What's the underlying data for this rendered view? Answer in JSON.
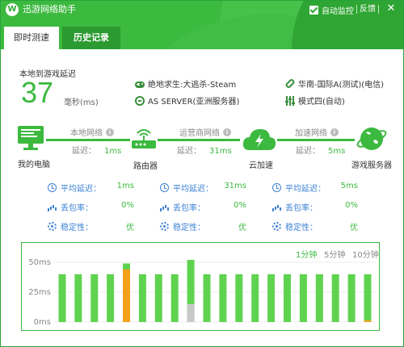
{
  "app": {
    "title": "迅游网络助手",
    "logo_text": "W",
    "auto_monitor_label": "自动监控",
    "auto_monitor_checked": true,
    "feedback_label": "反馈",
    "close_label": "✕"
  },
  "tabs": [
    {
      "label": "即时测速",
      "active": true
    },
    {
      "label": "历史记录",
      "active": false
    }
  ],
  "summary": {
    "latency_label": "本地到游戏延迟",
    "latency_value": "37",
    "latency_unit": "毫秒(ms)",
    "game": "绝地求生:大逃杀-Steam",
    "server": "AS SERVER(亚洲服务器)",
    "route": "华南-国际A(测试)(电信)",
    "mode": "模式四(自动)"
  },
  "nodes": [
    {
      "label": "我的电脑",
      "icon": "computer-icon"
    },
    {
      "label": "路由器",
      "icon": "router-icon"
    },
    {
      "label": "云加速",
      "icon": "cloud-accel-icon"
    },
    {
      "label": "游戏服务器",
      "icon": "game-server-icon"
    }
  ],
  "segments": [
    {
      "title": "本地网络",
      "latency_label": "延迟：",
      "latency": "1ms"
    },
    {
      "title": "运营商网络",
      "latency_label": "延迟：",
      "latency": "31ms"
    },
    {
      "title": "加速网络",
      "latency_label": "延迟：",
      "latency": "5ms"
    }
  ],
  "stats_labels": {
    "avg": "平均延迟：",
    "loss": "丢包率：",
    "stability": "稳定性："
  },
  "stats": [
    {
      "avg": "1ms",
      "loss": "0%",
      "stability": "优"
    },
    {
      "avg": "31ms",
      "loss": "0%",
      "stability": "优"
    },
    {
      "avg": "5ms",
      "loss": "0%",
      "stability": "优"
    }
  ],
  "time_ranges": [
    {
      "label": "1分钟",
      "active": true
    },
    {
      "label": "5分钟",
      "active": false
    },
    {
      "label": "10分钟",
      "active": false
    }
  ],
  "colors": {
    "brand": "#3cb93f",
    "accent_blue": "#3d82d4",
    "bar_normal": "#5fd34f",
    "bar_warn": "#f5a01a",
    "bar_loss": "#c8c8c8"
  },
  "chart_data": {
    "type": "bar",
    "ylim": [
      0,
      50
    ],
    "yticks": [
      "50ms",
      "25ms",
      "0ms"
    ],
    "ytick_values": [
      50,
      25,
      0
    ],
    "series": [
      {
        "values": [
          40,
          40,
          40,
          40,
          49,
          40,
          40,
          40,
          52,
          40,
          40,
          40,
          40,
          40,
          40,
          40,
          40,
          40,
          40,
          40
        ]
      }
    ],
    "warn_values": [
      0,
      0,
      0,
      0,
      44,
      0,
      0,
      0,
      0,
      0,
      0,
      0,
      0,
      0,
      0,
      0,
      0,
      0,
      0,
      0
    ],
    "loss_values": [
      0,
      0,
      0,
      0,
      0,
      0,
      0,
      0,
      15,
      0,
      0,
      0,
      0,
      0,
      0,
      0,
      0,
      0,
      0,
      0
    ],
    "baseline_warn": [
      0,
      0,
      0,
      0,
      0,
      0,
      0,
      0,
      0,
      0,
      0,
      0,
      0,
      0,
      0,
      0,
      0,
      0,
      0,
      1
    ]
  }
}
